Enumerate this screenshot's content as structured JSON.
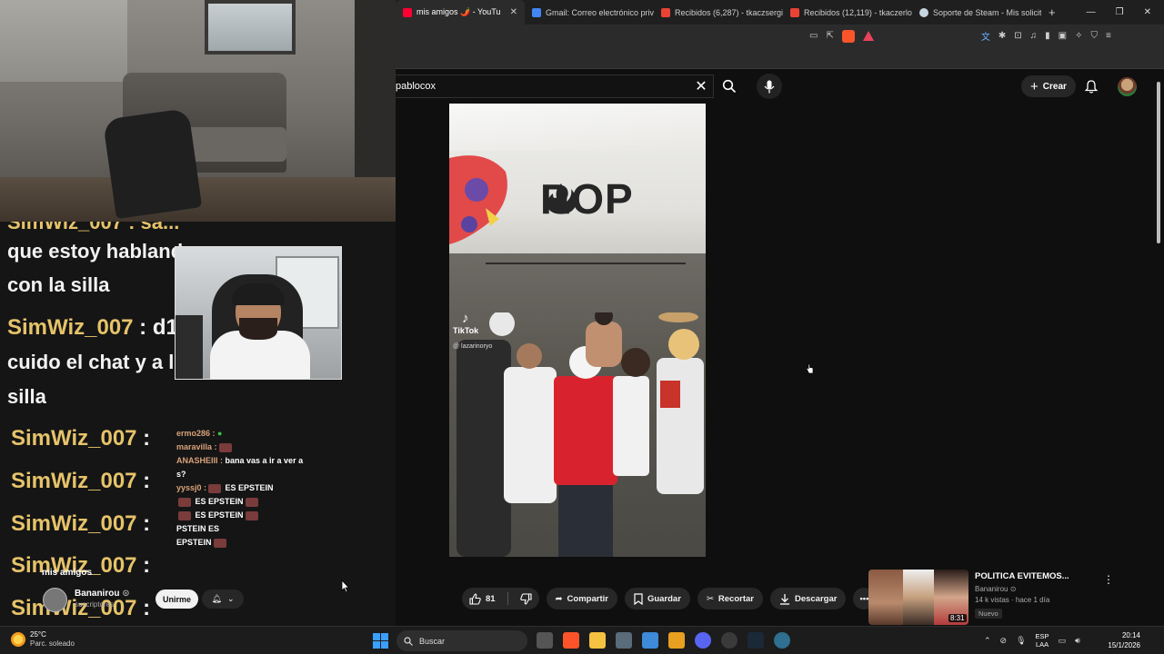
{
  "browser": {
    "tabs": [
      {
        "title": "mis amigos 🌶️ - YouTu",
        "active": true,
        "favicon_color": "#ff0033"
      },
      {
        "title": "Gmail: Correo electrónico priva",
        "active": false,
        "favicon_color": "#ea4335"
      },
      {
        "title": "Recibidos (6,287) - tkaczsergio",
        "active": false,
        "favicon_color": "#ea4335"
      },
      {
        "title": "Recibidos (12,119) - tkaczerlo",
        "active": false,
        "favicon_color": "#ea4335"
      },
      {
        "title": "Soporte de Steam - Mis solicitu",
        "active": false,
        "favicon_color": "#c7d5e0"
      }
    ],
    "new_tab_glyph": "+",
    "window_controls": [
      "—",
      "❐",
      "✕"
    ]
  },
  "youtube": {
    "search_value": "pablocox",
    "create_label": "Crear",
    "icons": [
      "close-icon",
      "search-icon",
      "mic-icon",
      "bell-icon"
    ]
  },
  "video": {
    "logo_text": "ROP",
    "tiktok_label": "TikTok",
    "tiktok_handle": "@ lazarinoryo"
  },
  "chat": {
    "cutoff_line": "SimWiz_007 : sa...",
    "messages": [
      {
        "user": "",
        "text": "que estoy hablando"
      },
      {
        "user": "",
        "text": "con la silla"
      },
      {
        "user": "SimWiz_007",
        "text": " : d1 te"
      },
      {
        "user": "",
        "text": "cuido el chat y a la"
      },
      {
        "user": "",
        "text": "silla"
      },
      {
        "user": "SimWiz_007",
        "text": " :"
      },
      {
        "user": "SimWiz_007",
        "text": " :"
      },
      {
        "user": "SimWiz_007",
        "text": " :"
      },
      {
        "user": "SimWiz_007",
        "text": " :"
      },
      {
        "user": "SimWiz_007",
        "text": " :"
      }
    ]
  },
  "mini_chat": [
    {
      "user": "ermo286 :",
      "text": ""
    },
    {
      "user": "maravilla :",
      "text": ""
    },
    {
      "user": "ANASHEIII :",
      "text": " bana vas a ir a ver a"
    },
    {
      "user": "",
      "text": "s?"
    },
    {
      "user": "yyssj0 :",
      "text": " ES EPSTEIN"
    },
    {
      "user": "",
      "text": " ES EPSTEIN"
    },
    {
      "user": "",
      "text": " ES EPSTEIN"
    },
    {
      "user": "",
      "text": "PSTEIN  ES"
    },
    {
      "user": "",
      "text": "EPSTEIN"
    }
  ],
  "below_video": {
    "title_fragment": "mis amigos",
    "channel_name": "Bananirou",
    "channel_subs": "suscriptores",
    "join_label": "Unirme",
    "likes": "81",
    "share_label": "Compartir",
    "save_label": "Guardar",
    "clip_label": "Recortar",
    "download_label": "Descargar"
  },
  "recommendation": {
    "title": "POLITICA EVITEMOS...",
    "channel": "Bananirou",
    "meta": "14 k vistas · hace 1 día",
    "badge": "Nuevo",
    "duration": "8:31"
  },
  "taskbar": {
    "temperature": "25°C",
    "weather_desc": "Parc. soleado",
    "search_label": "Buscar",
    "lang_top": "ESP",
    "lang_bottom": "LAA",
    "time": "20:14",
    "date": "15/1/2026"
  }
}
